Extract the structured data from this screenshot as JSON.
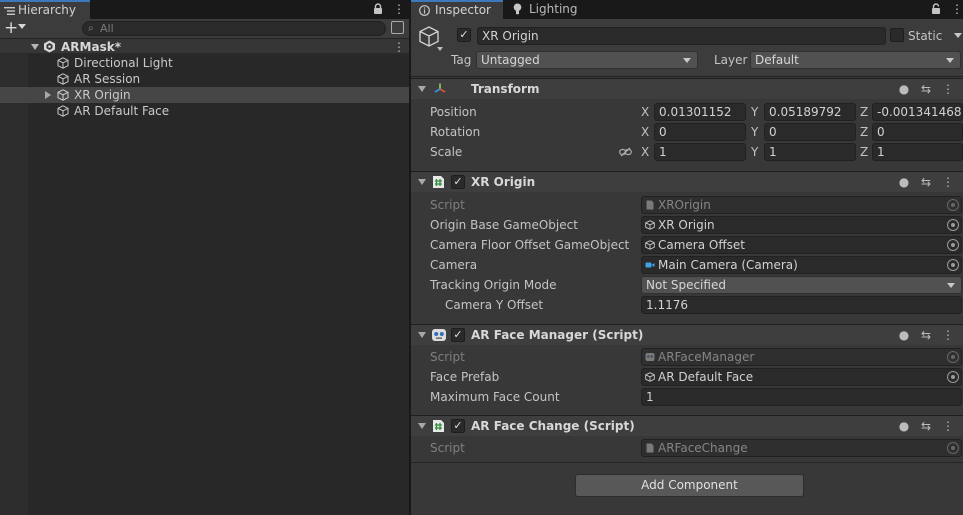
{
  "hierarchy": {
    "tab_label": "Hierarchy",
    "search_placeholder": "All",
    "scene": {
      "name": "ARMask*"
    },
    "items": [
      {
        "label": "Directional Light"
      },
      {
        "label": "AR Session"
      },
      {
        "label": "XR Origin"
      },
      {
        "label": "AR Default Face"
      }
    ]
  },
  "inspector": {
    "tabs": [
      {
        "label": "Inspector"
      },
      {
        "label": "Lighting"
      }
    ],
    "gameobject": {
      "name": "XR Origin",
      "static_label": "Static",
      "tag_label": "Tag",
      "tag_value": "Untagged",
      "layer_label": "Layer",
      "layer_value": "Default"
    },
    "transform": {
      "title": "Transform",
      "position": {
        "label": "Position",
        "x": "0.01301152",
        "y": "0.05189792",
        "z": "-0.001341468"
      },
      "rotation": {
        "label": "Rotation",
        "x": "0",
        "y": "0",
        "z": "0"
      },
      "scale": {
        "label": "Scale",
        "x": "1",
        "y": "1",
        "z": "1"
      },
      "axes": {
        "x": "X",
        "y": "Y",
        "z": "Z"
      }
    },
    "xr_origin": {
      "title": "XR Origin",
      "script_label": "Script",
      "script_value": "XROrigin",
      "origin_base_label": "Origin Base GameObject",
      "origin_base_value": "XR Origin",
      "camera_floor_label": "Camera Floor Offset GameObject",
      "camera_floor_value": "Camera Offset",
      "camera_label": "Camera",
      "camera_value": "Main Camera (Camera)",
      "tracking_mode_label": "Tracking Origin Mode",
      "tracking_mode_value": "Not Specified",
      "camera_y_label": "Camera Y Offset",
      "camera_y_value": "1.1176"
    },
    "face_manager": {
      "title": "AR Face Manager (Script)",
      "script_label": "Script",
      "script_value": "ARFaceManager",
      "prefab_label": "Face Prefab",
      "prefab_value": "AR Default Face",
      "max_label": "Maximum Face Count",
      "max_value": "1"
    },
    "face_change": {
      "title": "AR Face Change (Script)",
      "script_label": "Script",
      "script_value": "ARFaceChange"
    },
    "add_component_label": "Add Component"
  },
  "colors": {
    "accent": "#3a79bb",
    "panel_bg": "#383838",
    "hierarchy_bg": "#282828",
    "selection": "#464646",
    "camera_icon": "#3fa3e6"
  },
  "icons": [
    "lock-icon",
    "kebab-menu-icon",
    "cube-icon",
    "unity-scene-icon",
    "transform-icon",
    "script-hash-icon",
    "face-manager-icon",
    "help-icon",
    "preset-icon",
    "camera-icon",
    "constrain-proportions-icon",
    "object-picker-icon"
  ]
}
